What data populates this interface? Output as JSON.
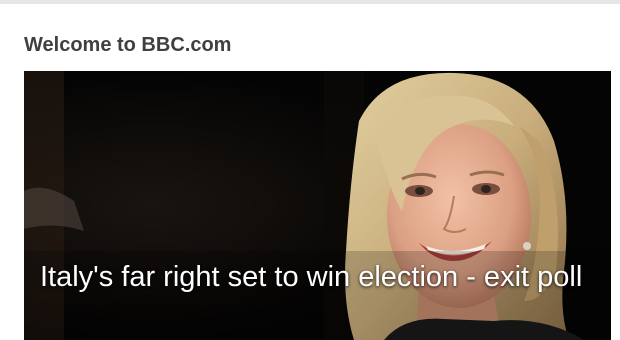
{
  "page": {
    "welcome_title": "Welcome to BBC.com"
  },
  "hero": {
    "headline": "Italy's far right set to win election - exit poll",
    "image_name": "woman-smiling-photo",
    "colors": {
      "background": "#050505",
      "hair": "#cdb487",
      "skin": "#e8b092",
      "headline_text": "#ffffff"
    }
  }
}
